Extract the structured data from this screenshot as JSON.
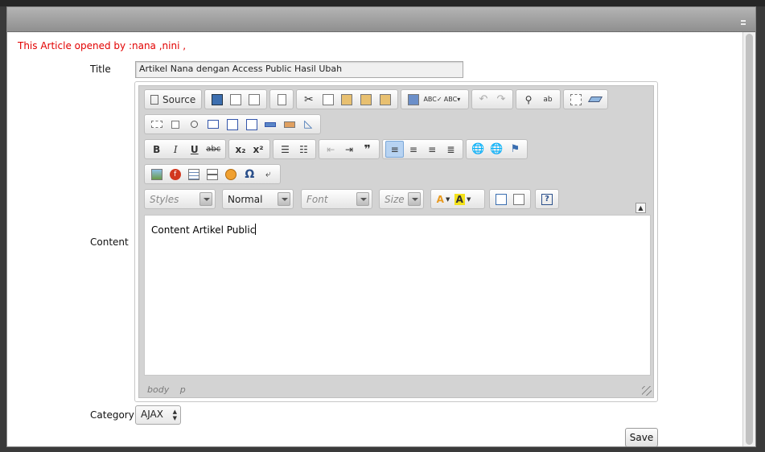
{
  "notice": {
    "opened_by": "This Article opened by :nana ,nini ,",
    "color": "#e20000"
  },
  "form": {
    "title_label": "Title",
    "title_value": "Artikel Nana dengan Access Public Hasil Ubah",
    "content_label": "Content",
    "category_label": "Category",
    "category_value": "AJAX",
    "save_label": "Save"
  },
  "editor": {
    "source_label": "Source",
    "styles_placeholder": "Styles",
    "format_value": "Normal",
    "font_placeholder": "Font",
    "size_placeholder": "Size",
    "body_text": "Content Artikel Public",
    "path": [
      "body",
      "p"
    ],
    "toolbar_icons": {
      "row1": [
        "source-icon",
        "save-icon",
        "new-page-icon",
        "preview-icon",
        "templates-icon",
        "cut-icon",
        "copy-icon",
        "paste-icon",
        "paste-text-icon",
        "paste-word-icon",
        "print-icon",
        "spellcheck-icon",
        "scayt-icon",
        "undo-icon",
        "redo-icon",
        "find-icon",
        "replace-icon",
        "select-all-icon",
        "remove-format-icon"
      ],
      "row2": [
        "form-icon",
        "checkbox-icon",
        "radio-icon",
        "textfield-icon",
        "textarea-icon",
        "select-icon",
        "button-icon",
        "image-button-icon",
        "hidden-field-icon"
      ],
      "row3": [
        "bold-icon",
        "italic-icon",
        "underline-icon",
        "strike-icon",
        "subscript-icon",
        "superscript-icon",
        "numbered-list-icon",
        "bulleted-list-icon",
        "outdent-icon",
        "indent-icon",
        "blockquote-icon",
        "align-left-icon",
        "align-center-icon",
        "align-right-icon",
        "justify-icon",
        "link-icon",
        "unlink-icon",
        "anchor-icon"
      ],
      "row4": [
        "image-icon",
        "flash-icon",
        "table-icon",
        "horizontal-rule-icon",
        "smiley-icon",
        "special-char-icon",
        "page-break-icon"
      ],
      "row5": [
        "text-color-icon",
        "bg-color-icon",
        "maximize-icon",
        "show-blocks-icon",
        "about-icon"
      ]
    },
    "glyphs": {
      "bold": "B",
      "italic": "I",
      "underline": "U",
      "strike": "abc",
      "subscript": "x₂",
      "superscript": "x²",
      "blockquote": "❞",
      "omega": "Ω",
      "about": "?",
      "color_a": "A"
    }
  }
}
